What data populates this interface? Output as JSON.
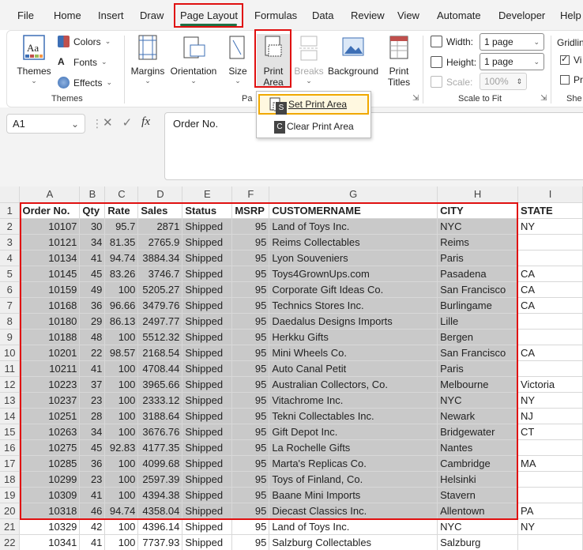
{
  "menu_tabs": [
    "File",
    "Home",
    "Insert",
    "Draw",
    "Page Layout",
    "Formulas",
    "Data",
    "Review",
    "View",
    "Automate",
    "Developer",
    "Help"
  ],
  "active_tab": "Page Layout",
  "ribbon": {
    "themes": {
      "themes_label": "Themes",
      "colors_label": "Colors",
      "fonts_label": "Fonts",
      "effects_label": "Effects",
      "group_label": "Themes"
    },
    "page_setup": {
      "margins_label": "Margins",
      "orientation_label": "Orientation",
      "size_label": "Size",
      "print_area_line1": "Print",
      "print_area_line2": "Area",
      "breaks_label": "Breaks",
      "background_label": "Background",
      "print_titles_line1": "Print",
      "print_titles_line2": "Titles",
      "group_label": "Pa"
    },
    "scale_to_fit": {
      "width_label": "Width:",
      "width_value": "1 page",
      "height_label": "Height:",
      "height_value": "1 page",
      "scale_label": "Scale:",
      "scale_value": "100%",
      "group_label": "Scale to Fit"
    },
    "sheet_options": {
      "gridlines_label": "Gridlin",
      "view_label": "Vi",
      "print_label": "Pr",
      "group_label": "She"
    }
  },
  "print_area_menu": {
    "set_label": "Set Print Area",
    "set_key": "S",
    "clear_label": "Clear Print Area",
    "clear_key": "C"
  },
  "formula_bar": {
    "name_box": "A1",
    "formula": "Order No."
  },
  "columns": [
    "A",
    "B",
    "C",
    "D",
    "E",
    "F",
    "G",
    "H",
    "I"
  ],
  "header_row": [
    "Order No.",
    "Qty",
    "Rate",
    "Sales",
    "Status",
    "MSRP",
    "CUSTOMERNAME",
    "CITY",
    "STATE"
  ],
  "rows": [
    [
      "10107",
      "30",
      "95.7",
      "2871",
      "Shipped",
      "95",
      "Land of Toys Inc.",
      "NYC",
      "NY"
    ],
    [
      "10121",
      "34",
      "81.35",
      "2765.9",
      "Shipped",
      "95",
      "Reims Collectables",
      "Reims",
      ""
    ],
    [
      "10134",
      "41",
      "94.74",
      "3884.34",
      "Shipped",
      "95",
      "Lyon Souveniers",
      "Paris",
      ""
    ],
    [
      "10145",
      "45",
      "83.26",
      "3746.7",
      "Shipped",
      "95",
      "Toys4GrownUps.com",
      "Pasadena",
      "CA"
    ],
    [
      "10159",
      "49",
      "100",
      "5205.27",
      "Shipped",
      "95",
      "Corporate Gift Ideas Co.",
      "San Francisco",
      "CA"
    ],
    [
      "10168",
      "36",
      "96.66",
      "3479.76",
      "Shipped",
      "95",
      "Technics Stores Inc.",
      "Burlingame",
      "CA"
    ],
    [
      "10180",
      "29",
      "86.13",
      "2497.77",
      "Shipped",
      "95",
      "Daedalus Designs Imports",
      "Lille",
      ""
    ],
    [
      "10188",
      "48",
      "100",
      "5512.32",
      "Shipped",
      "95",
      "Herkku Gifts",
      "Bergen",
      ""
    ],
    [
      "10201",
      "22",
      "98.57",
      "2168.54",
      "Shipped",
      "95",
      "Mini Wheels Co.",
      "San Francisco",
      "CA"
    ],
    [
      "10211",
      "41",
      "100",
      "4708.44",
      "Shipped",
      "95",
      "Auto Canal Petit",
      "Paris",
      ""
    ],
    [
      "10223",
      "37",
      "100",
      "3965.66",
      "Shipped",
      "95",
      "Australian Collectors, Co.",
      "Melbourne",
      "Victoria"
    ],
    [
      "10237",
      "23",
      "100",
      "2333.12",
      "Shipped",
      "95",
      "Vitachrome Inc.",
      "NYC",
      "NY"
    ],
    [
      "10251",
      "28",
      "100",
      "3188.64",
      "Shipped",
      "95",
      "Tekni Collectables Inc.",
      "Newark",
      "NJ"
    ],
    [
      "10263",
      "34",
      "100",
      "3676.76",
      "Shipped",
      "95",
      "Gift Depot Inc.",
      "Bridgewater",
      "CT"
    ],
    [
      "10275",
      "45",
      "92.83",
      "4177.35",
      "Shipped",
      "95",
      "La Rochelle Gifts",
      "Nantes",
      ""
    ],
    [
      "10285",
      "36",
      "100",
      "4099.68",
      "Shipped",
      "95",
      "Marta's Replicas Co.",
      "Cambridge",
      "MA"
    ],
    [
      "10299",
      "23",
      "100",
      "2597.39",
      "Shipped",
      "95",
      "Toys of Finland, Co.",
      "Helsinki",
      ""
    ],
    [
      "10309",
      "41",
      "100",
      "4394.38",
      "Shipped",
      "95",
      "Baane Mini Imports",
      "Stavern",
      ""
    ],
    [
      "10318",
      "46",
      "94.74",
      "4358.04",
      "Shipped",
      "95",
      "Diecast Classics Inc.",
      "Allentown",
      "PA"
    ],
    [
      "10329",
      "42",
      "100",
      "4396.14",
      "Shipped",
      "95",
      "Land of Toys Inc.",
      "NYC",
      "NY"
    ],
    [
      "10341",
      "41",
      "100",
      "7737.93",
      "Shipped",
      "95",
      "Salzburg Collectables",
      "Salzburg",
      ""
    ]
  ],
  "colors": {
    "accent_green": "#1e7145",
    "highlight_red": "#e01010",
    "menu_highlight": "#f0a800",
    "selection_gray": "#c9c9c9"
  }
}
